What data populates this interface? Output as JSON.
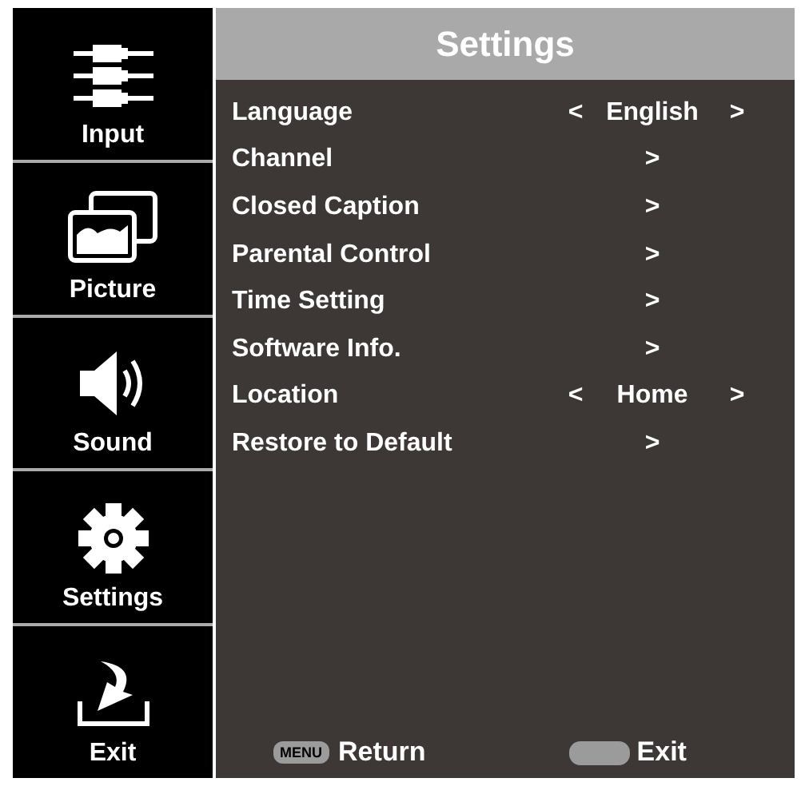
{
  "sidebar": {
    "items": [
      {
        "label": "Input"
      },
      {
        "label": "Picture"
      },
      {
        "label": "Sound"
      },
      {
        "label": "Settings"
      },
      {
        "label": "Exit"
      }
    ]
  },
  "panel": {
    "title": "Settings",
    "rows": [
      {
        "kind": "select",
        "label": "Language",
        "left": "<",
        "value": "English",
        "right": ">"
      },
      {
        "kind": "submenu",
        "label": "Channel",
        "right": ">"
      },
      {
        "kind": "submenu",
        "label": "Closed Caption",
        "right": ">"
      },
      {
        "kind": "submenu",
        "label": "Parental Control",
        "right": ">"
      },
      {
        "kind": "submenu",
        "label": "Time Setting",
        "right": ">"
      },
      {
        "kind": "submenu",
        "label": "Software Info.",
        "right": ">"
      },
      {
        "kind": "select",
        "label": "Location",
        "left": "<",
        "value": "Home",
        "right": ">"
      },
      {
        "kind": "submenu",
        "label": "Restore to Default",
        "right": ">"
      }
    ],
    "footer": [
      {
        "key": "MENU",
        "label": "Return"
      },
      {
        "label": "Exit"
      }
    ]
  }
}
